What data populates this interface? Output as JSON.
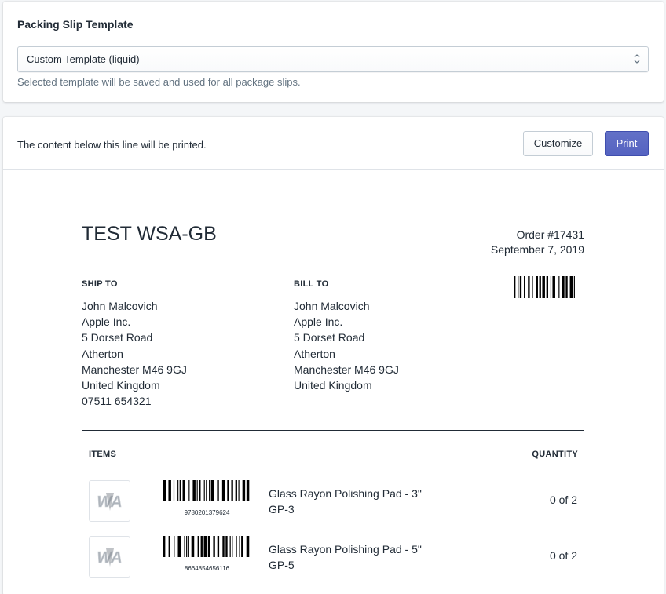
{
  "template_card": {
    "title": "Packing Slip Template",
    "selected": "Custom Template (liquid)",
    "help": "Selected template will be saved and used for all package slips."
  },
  "preview_card": {
    "note": "The content below this line will be printed.",
    "customize_label": "Customize",
    "print_label": "Print"
  },
  "slip": {
    "shop_name": "TEST WSA-GB",
    "order_number": "Order #17431",
    "order_date": "September 7, 2019",
    "ship_to": {
      "heading": "SHIP TO",
      "lines": [
        "John Malcovich",
        "Apple Inc.",
        "5 Dorset Road",
        "Atherton",
        "Manchester M46 9GJ",
        "United Kingdom",
        "07511 654321"
      ]
    },
    "bill_to": {
      "heading": "BILL TO",
      "lines": [
        "John Malcovich",
        "Apple Inc.",
        "5 Dorset Road",
        "Atherton",
        "Manchester M46 9GJ",
        "United Kingdom"
      ]
    },
    "items_heading": "ITEMS",
    "quantity_heading": "QUANTITY",
    "items": [
      {
        "title": "Glass Rayon Polishing Pad - 3\"",
        "sku": "GP-3",
        "barcode": "9780201379624",
        "quantity": "0 of 2",
        "thumb_icon": "wsa-logo-icon"
      },
      {
        "title": "Glass Rayon Polishing Pad - 5\"",
        "sku": "GP-5",
        "barcode": "8664854656116",
        "quantity": "0 of 2",
        "thumb_icon": "wsa-logo-icon"
      }
    ]
  },
  "colors": {
    "primary": "#5c6ac4",
    "border": "#c4cdd5",
    "text": "#212b36",
    "subdued": "#637381"
  }
}
